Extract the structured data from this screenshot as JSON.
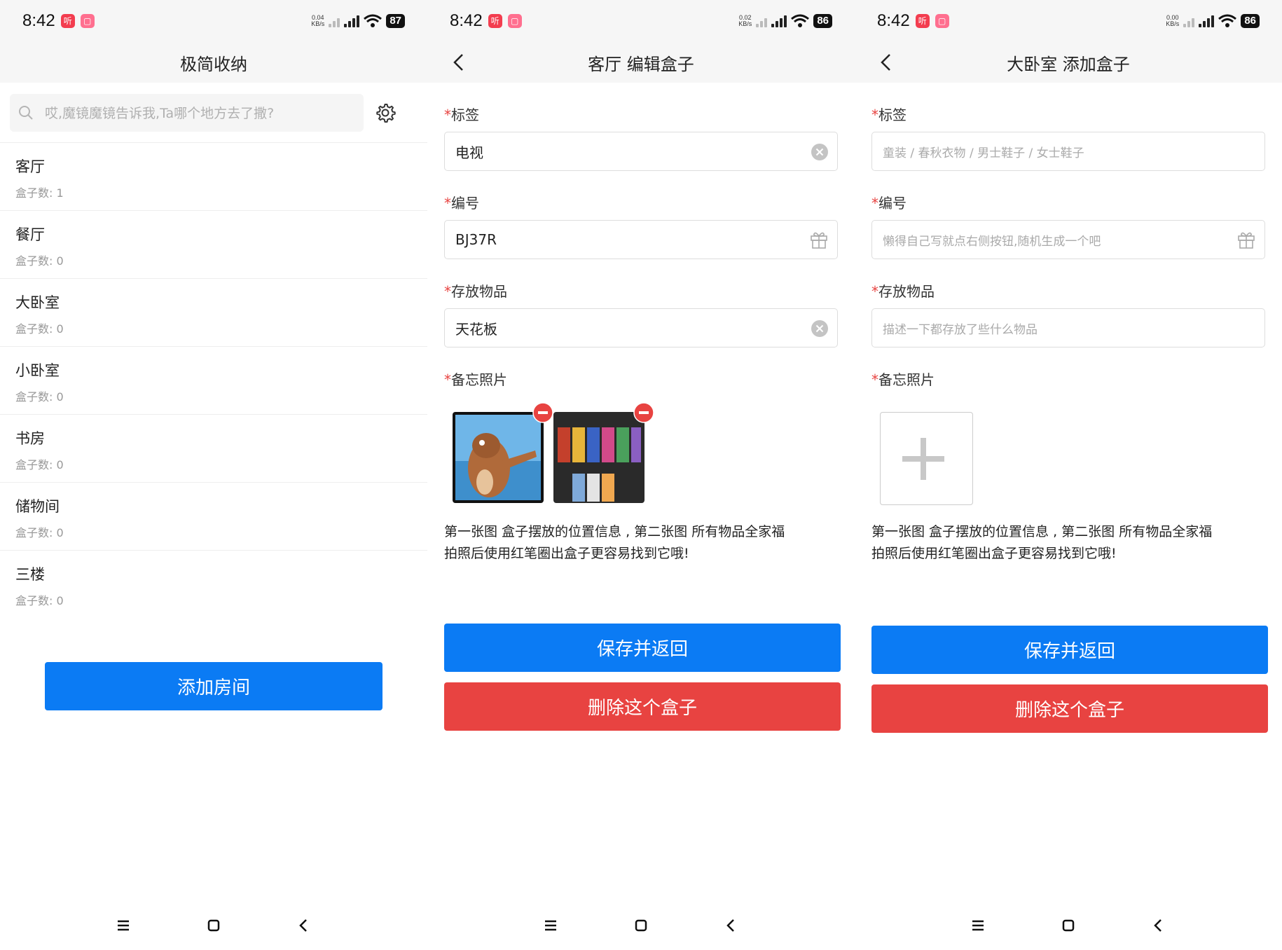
{
  "status": {
    "time": "8:42",
    "badge1": "听",
    "screens": [
      {
        "speed_top": "0.04",
        "speed_unit": "KB/s",
        "battery": "87"
      },
      {
        "speed_top": "0.02",
        "speed_unit": "KB/s",
        "battery": "86"
      },
      {
        "speed_top": "0.00",
        "speed_unit": "KB/s",
        "battery": "86"
      }
    ]
  },
  "rooms_screen": {
    "title": "极简收纳",
    "search_placeholder": "哎,魔镜魔镜告诉我,Ta哪个地方去了撒?",
    "rooms": [
      {
        "name": "客厅",
        "count": "盒子数: 1"
      },
      {
        "name": "餐厅",
        "count": "盒子数: 0"
      },
      {
        "name": "大卧室",
        "count": "盒子数: 0"
      },
      {
        "name": "小卧室",
        "count": "盒子数: 0"
      },
      {
        "name": "书房",
        "count": "盒子数: 0"
      },
      {
        "name": "储物间",
        "count": "盒子数: 0"
      },
      {
        "name": "三楼",
        "count": "盒子数: 0"
      }
    ],
    "add_room_label": "添加房间"
  },
  "edit_screen": {
    "title": "客厅 编辑盒子",
    "required_mark": "*",
    "tag_label": "标签",
    "tag_value": "电视",
    "code_label": "编号",
    "code_value": "BJ37R",
    "items_label": "存放物品",
    "items_value": "天花板",
    "photos_label": "备忘照片",
    "hint_line1": "第一张图 盒子摆放的位置信息 , 第二张图 所有物品全家福",
    "hint_line2": "拍照后使用红笔圈出盒子更容易找到它哦!",
    "save_label": "保存并返回",
    "delete_label": "删除这个盒子"
  },
  "add_screen": {
    "title": "大卧室 添加盒子",
    "required_mark": "*",
    "tag_label": "标签",
    "tag_placeholder": "童装 / 春秋衣物 / 男士鞋子 / 女士鞋子",
    "code_label": "编号",
    "code_placeholder": "懒得自己写就点右侧按钮,随机生成一个吧",
    "items_label": "存放物品",
    "items_placeholder": "描述一下都存放了些什么物品",
    "photos_label": "备忘照片",
    "hint_line1": "第一张图 盒子摆放的位置信息 , 第二张图 所有物品全家福",
    "hint_line2": "拍照后使用红笔圈出盒子更容易找到它哦!",
    "save_label": "保存并返回",
    "delete_label": "删除这个盒子"
  },
  "colors": {
    "primary": "#0b7bf4",
    "danger": "#e84341",
    "header_bg": "#f6f6f6"
  }
}
